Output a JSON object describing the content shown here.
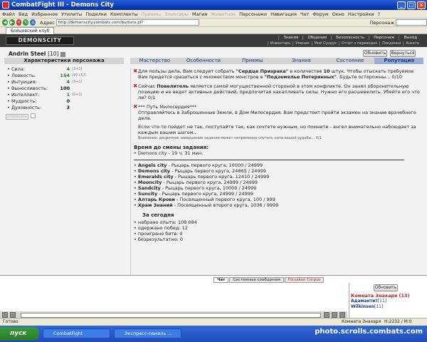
{
  "window": {
    "title": "CombatFight III - Demons City"
  },
  "menu": {
    "items": [
      "Файл",
      "Вид",
      "Избранное",
      "Утилиты",
      "Поделки",
      "Комплекты",
      "Приемы",
      "Эликсиры",
      "Магия",
      "Животное",
      "Персонажи",
      "Навигация",
      "Чат",
      "Форум",
      "Окно",
      "Настройки",
      "?"
    ],
    "dim": [
      6,
      7,
      9
    ]
  },
  "toolbar": {
    "address_label": "Адрес",
    "url": "http://demonscity.combats.com/buttons.pl?battle=0.560029509988744",
    "search_label": "Персонаж"
  },
  "browser_tab": "Бойцовский клуб",
  "header": {
    "logo": "DEMONSCITY",
    "nav1": [
      "Знания",
      "Общение",
      "Безопасность",
      "Персонаж",
      "Выход"
    ],
    "nav2": [
      "Инвентарь",
      "Умения",
      "Мой Сундук",
      "Отчет о переводах",
      "Поединки",
      "Анкета"
    ]
  },
  "character": {
    "name": "Andrin Steel",
    "level": "[10]"
  },
  "buttons": {
    "refresh": "Обновить",
    "back": "Вернуться",
    "save": "сохранить"
  },
  "sidebar": {
    "title": "Характеристики персонажа",
    "stats": [
      {
        "label": "Сила:",
        "value": "4",
        "bonus": "(3+1)",
        "green": true
      },
      {
        "label": "Ловкость:",
        "value": "154",
        "bonus": "(97+57)",
        "green": true
      },
      {
        "label": "Интуиция:",
        "value": "4",
        "bonus": "(3+1)",
        "green": true
      },
      {
        "label": "Выносливость:",
        "value": "100",
        "bonus": "",
        "green": false
      },
      {
        "label": "Интеллект:",
        "value": "1",
        "bonus": "(0+1)",
        "green": true
      },
      {
        "label": "Мудрость:",
        "value": "0",
        "bonus": "",
        "green": false
      },
      {
        "label": "Духовность:",
        "value": "3",
        "bonus": "",
        "green": false
      }
    ]
  },
  "tabs": {
    "items": [
      "Мастерство",
      "Особенности",
      "Приемы",
      "Знания",
      "Состояние",
      "Репутация"
    ],
    "active": 5
  },
  "quests": {
    "q1": {
      "pre": "Для пользы дела, Вам следует собрать ",
      "bold1": "\"Сердце Призрака\"",
      "mid": " в количестве ",
      "bold2": "10",
      "post": " штук. Чтобы отыскать требуемое Вам придется сразиться с множеством монстров в ",
      "bold3": "\"Подземелье Потерянных\"",
      "end": ". Будьте осторожны... 0/10"
    },
    "q2": {
      "pre": "Сейчас ",
      "bold1": "Повелитель",
      "post": " является самой могущественной стороной в этом конфликте. Он занял оборонительную позицию и не ведет активных действий, предпочитая накапливать силы. Нужно его расшевелить. Убейте его что ли? 0/1"
    },
    "q3": {
      "title": "*** Путь Милосердия***",
      "line1": "Отправляйтесь в Заброшенные Земли, в Дом Милосердия. Вам предстоит пройти экзамен на знание врачебного дела.",
      "line2": "Если что-то пойдет не так, поступайте так, как сочтете нужным, но помните - ангел внимательно наблюдает за каждым вашим шагом..",
      "note": "Внимание: досрочное завершение задания может непременно спутать нити вашей судьбы... 0/1"
    }
  },
  "reset": {
    "title": "Время до смены задания:",
    "value": "• Demons city - 19 ч. 31 мин."
  },
  "cities": [
    {
      "name": "Angels city",
      "rest": " - Рыцарь первого круга, 10000 / 24999"
    },
    {
      "name": "Demons city",
      "rest": " - Рыцарь первого круга, 24865 / 24999"
    },
    {
      "name": "Emeralds city",
      "rest": " - Рыцарь первого круга, 12410 / 24999"
    },
    {
      "name": "Mooncity",
      "rest": " - Рыцарь первого круга, 24999 / 24999"
    },
    {
      "name": "Sandcity",
      "rest": " - Рыцарь первого круга, 10000 / 24999"
    },
    {
      "name": "Suncity",
      "rest": " - Рыцарь первого круга, 24999 / 24999"
    },
    {
      "name": "Алтарь Крови",
      "rest": " - Посвященный первого круга, 100 / 999"
    },
    {
      "name": "Храм Знаний",
      "rest": " - Посвященный второго круга, 1036 / 9999"
    }
  ],
  "today": {
    "title": "За сегодня",
    "rows": [
      "• набрано опыта: 108 084",
      "• одержано побед: 12",
      "• проиграно битв: 0",
      "• безрезультатно: 0"
    ]
  },
  "chat": {
    "tabs": [
      "Чат",
      "Системные сообщения",
      "Forsaken Corpse"
    ],
    "refresh": "Обновить",
    "room": "Комната Знахаря (13)",
    "users": [
      {
        "name": "Адамантит",
        "level": "[11]"
      },
      {
        "name": "Wilkinson",
        "level": "[11]"
      }
    ]
  },
  "status": {
    "left": "Готово",
    "right": "Комната Знахаря",
    "coord": "Н:2232 / М:0"
  },
  "taskbar": {
    "start": "пуск",
    "tasks": [
      "CombatFight",
      "Экспресс-панель ..."
    ],
    "watermark": "photo.scrolls.combats.com"
  }
}
